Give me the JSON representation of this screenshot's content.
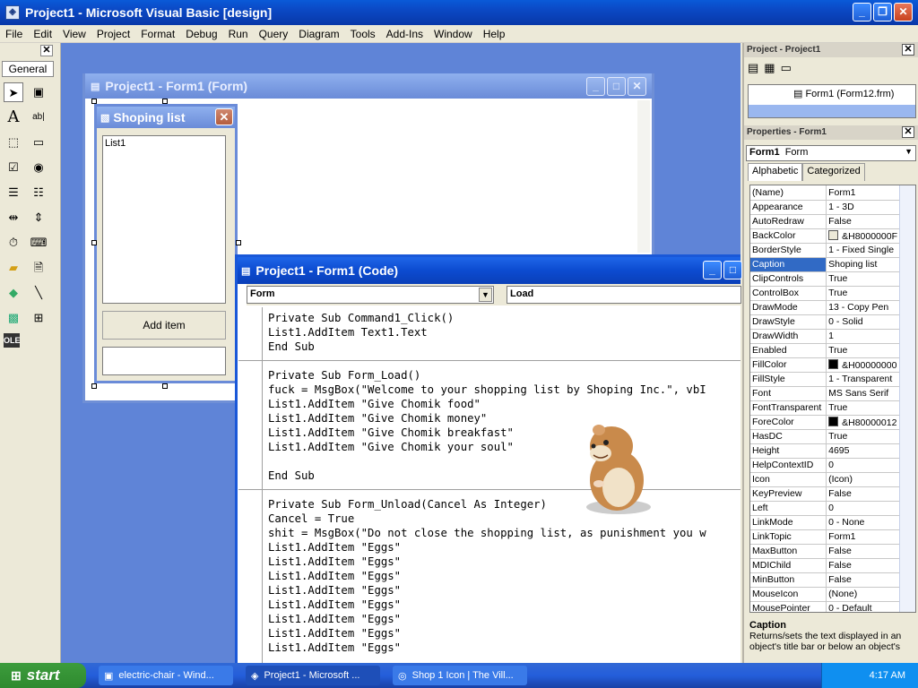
{
  "window": {
    "title": "Project1 - Microsoft Visual Basic [design]",
    "app_icon": "vb-icon"
  },
  "menu": [
    "File",
    "Edit",
    "View",
    "Project",
    "Format",
    "Debug",
    "Run",
    "Query",
    "Diagram",
    "Tools",
    "Add-Ins",
    "Window",
    "Help"
  ],
  "toolbox": {
    "tab_label": "General"
  },
  "form_window": {
    "title": "Project1 - Form1 (Form)",
    "designer_form": {
      "caption": "Shoping list",
      "listbox_text": "List1",
      "button_label": "Add item"
    }
  },
  "code_window": {
    "title": "Project1 - Form1 (Code)",
    "object_combo": "Form",
    "proc_combo": "Load",
    "blocks": [
      [
        "Private Sub Command1_Click()",
        "List1.AddItem Text1.Text",
        "End Sub"
      ],
      [
        "Private Sub Form_Load()",
        "fuck = MsgBox(\"Welcome to your shopping list by Shoping Inc.\", vbI",
        "List1.AddItem \"Give Chomik food\"",
        "List1.AddItem \"Give Chomik money\"",
        "List1.AddItem \"Give Chomik breakfast\"",
        "List1.AddItem \"Give Chomik your soul\"",
        "",
        "End Sub"
      ],
      [
        "Private Sub Form_Unload(Cancel As Integer)",
        "Cancel = True",
        "shit = MsgBox(\"Do not close the shopping list, as punishment you w",
        "List1.AddItem \"Eggs\"",
        "List1.AddItem \"Eggs\"",
        "List1.AddItem \"Eggs\"",
        "List1.AddItem \"Eggs\"",
        "List1.AddItem \"Eggs\"",
        "List1.AddItem \"Eggs\"",
        "List1.AddItem \"Eggs\"",
        "List1.AddItem \"Eggs\""
      ]
    ]
  },
  "project_panel": {
    "title": "Project - Project1",
    "tree_item": "Form1 (Form12.frm)"
  },
  "properties_panel": {
    "title": "Properties - Form1",
    "object_name": "Form1",
    "object_type": "Form",
    "tabs": [
      "Alphabetic",
      "Categorized"
    ],
    "selected_property": "Caption",
    "rows": [
      [
        "(Name)",
        "Form1"
      ],
      [
        "Appearance",
        "1 - 3D"
      ],
      [
        "AutoRedraw",
        "False"
      ],
      [
        "BackColor",
        "&H8000000F"
      ],
      [
        "BorderStyle",
        "1 - Fixed Single"
      ],
      [
        "Caption",
        "Shoping list"
      ],
      [
        "ClipControls",
        "True"
      ],
      [
        "ControlBox",
        "True"
      ],
      [
        "DrawMode",
        "13 - Copy Pen"
      ],
      [
        "DrawStyle",
        "0 - Solid"
      ],
      [
        "DrawWidth",
        "1"
      ],
      [
        "Enabled",
        "True"
      ],
      [
        "FillColor",
        "&H00000000"
      ],
      [
        "FillStyle",
        "1 - Transparent"
      ],
      [
        "Font",
        "MS Sans Serif"
      ],
      [
        "FontTransparent",
        "True"
      ],
      [
        "ForeColor",
        "&H80000012"
      ],
      [
        "HasDC",
        "True"
      ],
      [
        "Height",
        "4695"
      ],
      [
        "HelpContextID",
        "0"
      ],
      [
        "Icon",
        "(Icon)"
      ],
      [
        "KeyPreview",
        "False"
      ],
      [
        "Left",
        "0"
      ],
      [
        "LinkMode",
        "0 - None"
      ],
      [
        "LinkTopic",
        "Form1"
      ],
      [
        "MaxButton",
        "False"
      ],
      [
        "MDIChild",
        "False"
      ],
      [
        "MinButton",
        "False"
      ],
      [
        "MouseIcon",
        "(None)"
      ],
      [
        "MousePointer",
        "0 - Default"
      ]
    ],
    "swatches": {
      "BackColor": "#ece9d8",
      "FillColor": "#000000",
      "ForeColor": "#000000"
    },
    "description_title": "Caption",
    "description_text": "Returns/sets the text displayed in an object's title bar or below an object's"
  },
  "taskbar": {
    "start_label": "start",
    "tasks": [
      "electric-chair - Wind...",
      "Project1 - Microsoft ...",
      "Shop 1 Icon | The Vill..."
    ],
    "clock": "4:17 AM"
  },
  "colors": {
    "mdi_background": "#5f84d7",
    "active_title": "#0b48c4",
    "selection": "#316ac5"
  }
}
